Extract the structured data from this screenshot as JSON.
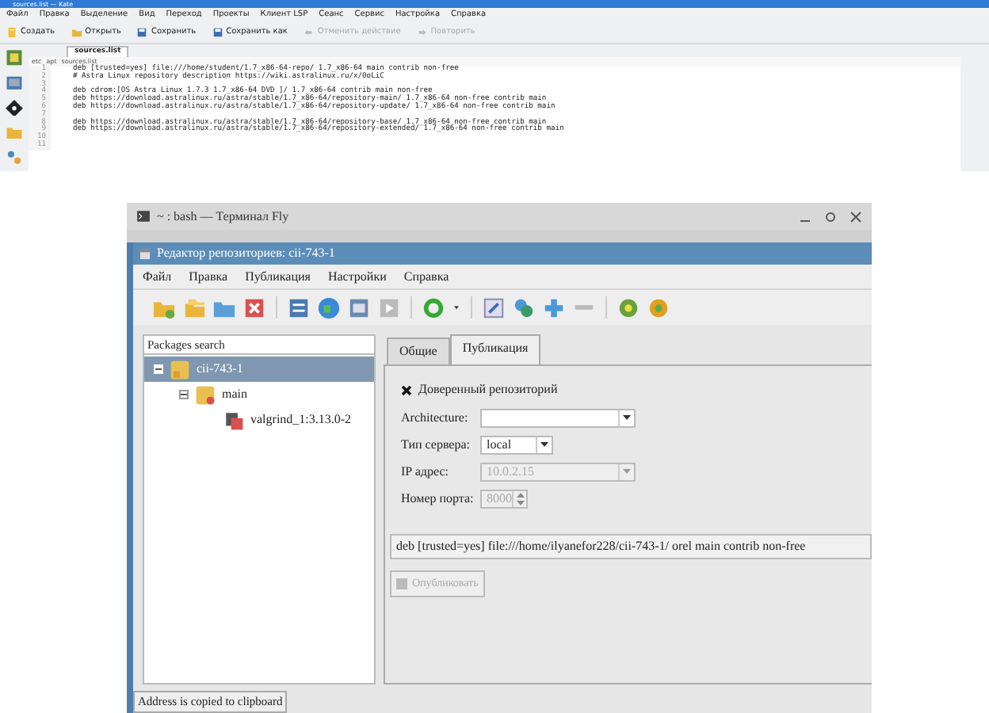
{
  "editor": {
    "title": "sources.list — Kate",
    "menu": [
      "Файл",
      "Правка",
      "Выделение",
      "Вид",
      "Переход",
      "Проекты",
      "Клиент LSP",
      "Сеанс",
      "Сервис",
      "Настройка",
      "Справка"
    ],
    "toolbar": [
      {
        "label": "Создать",
        "disabled": false
      },
      {
        "label": "Открыть",
        "disabled": false
      },
      {
        "label": "Сохранить",
        "disabled": false
      },
      {
        "label": "Сохранить как",
        "disabled": false
      },
      {
        "label": "Отменить действие",
        "disabled": true
      },
      {
        "label": "Повторить",
        "disabled": true
      }
    ],
    "tabs": [
      {
        "label": "sources.list",
        "selected": true
      }
    ],
    "breadcrumb": [
      "etc",
      "apt",
      "sources.list"
    ],
    "lines": [
      {
        "number": "1",
        "text": "deb [trusted=yes] file:///home/student/1.7_x86-64-repo/ 1.7_x86-64 main contrib non-free"
      },
      {
        "number": "2",
        "text": "# Astra Linux repository description https://wiki.astralinux.ru/x/0oLiC"
      },
      {
        "number": "3"
      },
      {
        "number": "4",
        "text": "deb cdrom:[OS Astra Linux 1.7.3 1.7_x86-64 DVD ]/ 1.7_x86-64 contrib main non-free"
      },
      {
        "number": "5",
        "text": "deb https://download.astralinux.ru/astra/stable/1.7_x86-64/repository-main/ 1.7_x86-64 non-free contrib main"
      },
      {
        "number": "6",
        "text": "deb https://download.astralinux.ru/astra/stable/1.7_x86-64/repository-update/ 1.7_x86-64 non-free contrib main"
      },
      {
        "number": "7"
      },
      {
        "number": "8",
        "text": "deb https://download.astralinux.ru/astra/stable/1.7_x86-64/repository-base/ 1.7_x86-64 non-free contrib main"
      },
      {
        "number": "9",
        "text": "deb https://download.astralinux.ru/astra/stable/1.7_x86-64/repository-extended/ 1.7_x86-64 non-free contrib main"
      },
      {
        "number": "10"
      },
      {
        "number": "11"
      }
    ]
  },
  "terminal": {
    "title": "~ : bash — Терминал Fly"
  },
  "repo_editor": {
    "title": "Редактор репозиториев: cii-743-1",
    "menu": [
      "Файл",
      "Правка",
      "Публикация",
      "Настройки",
      "Справка"
    ],
    "search": {
      "placeholder": "Packages search"
    },
    "tree": [
      {
        "label": "cii-743-1",
        "selected": true,
        "expanded": true,
        "children": [
          {
            "label": "main",
            "selected": false,
            "expanded": true,
            "children": [
              {
                "label": "valgrind_1:3.13.0-2",
                "selected": false
              }
            ]
          }
        ]
      }
    ],
    "tabs": [
      {
        "label": "Общие",
        "selected": false
      },
      {
        "label": "Публикация",
        "selected": true
      }
    ],
    "trusted": {
      "label": "Доверенный репозиторий",
      "checked": true
    },
    "fields": [
      {
        "label": "Architecture:",
        "kind": "combo",
        "disabled": false
      },
      {
        "label": "Тип сервера:",
        "kind": "short_combo",
        "value": "local",
        "disabled": false
      },
      {
        "label": "IP адрес:",
        "kind": "combo",
        "value": "10.0.2.15",
        "disabled": true
      },
      {
        "label": "Номер порта:",
        "kind": "spin",
        "value": "8000",
        "disabled": true
      }
    ],
    "source_line": "deb [trusted=yes] file:///home/ilyanefor228/cii-743-1/ orel main contrib non-free",
    "publish": {
      "label": "Опубликовать",
      "disabled": true
    },
    "status": "Address is copied to clipboard"
  }
}
